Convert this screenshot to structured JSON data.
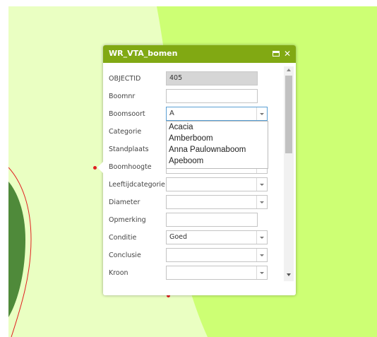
{
  "popup": {
    "title": "WR_VTA_bomen",
    "fields": [
      {
        "label": "OBJECTID",
        "value": "405"
      },
      {
        "label": "Boomnr",
        "value": ""
      },
      {
        "label": "Boomsoort",
        "value": "A"
      },
      {
        "label": "Categorie",
        "value": ""
      },
      {
        "label": "Standplaats",
        "value": ""
      },
      {
        "label": "Boomhoogte",
        "value": ""
      },
      {
        "label": "Leeftijdcategorie",
        "value": ""
      },
      {
        "label": "Diameter",
        "value": ""
      },
      {
        "label": "Opmerking",
        "value": ""
      },
      {
        "label": "Conditie",
        "value": "Goed"
      },
      {
        "label": "Conclusie",
        "value": ""
      },
      {
        "label": "Kroon",
        "value": ""
      }
    ],
    "dropdown_options": [
      "Acacia",
      "Amberboom",
      "Anna Paulownaboom",
      "Apeboom"
    ]
  },
  "colors": {
    "header": "#81a913",
    "map_light": "#eaffc2",
    "map_lime": "#cdff74",
    "map_dark_green": "#4f8a3a",
    "boundary": "#e02020"
  },
  "icons": [
    "maximize-icon",
    "close-icon",
    "dropdown-arrow-icon",
    "scroll-up-icon",
    "scroll-down-icon"
  ]
}
